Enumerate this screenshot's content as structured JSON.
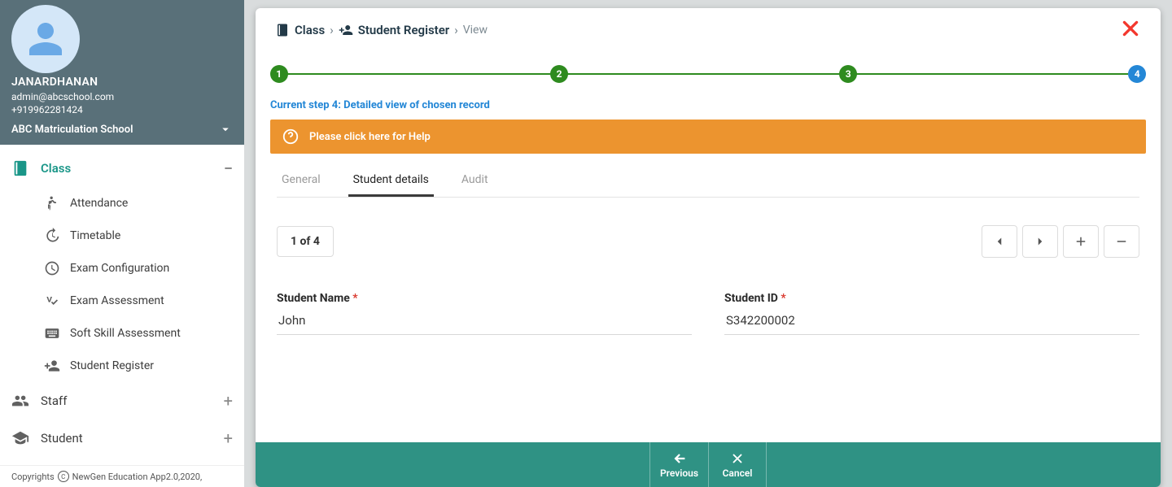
{
  "user": {
    "name": "JANARDHANAN",
    "email": "admin@abcschool.com",
    "phone": "+919962281424",
    "school": "ABC Matriculation School"
  },
  "sidebar": {
    "sections": {
      "class": {
        "label": "Class"
      },
      "staff": {
        "label": "Staff"
      },
      "student": {
        "label": "Student"
      }
    },
    "class_items": [
      {
        "label": "Attendance"
      },
      {
        "label": "Timetable"
      },
      {
        "label": "Exam Configuration"
      },
      {
        "label": "Exam Assessment"
      },
      {
        "label": "Soft Skill Assessment"
      },
      {
        "label": "Student Register"
      }
    ]
  },
  "breadcrumb": {
    "root": "Class",
    "module": "Student Register",
    "leaf": "View"
  },
  "stepper": {
    "steps": [
      "1",
      "2",
      "3",
      "4"
    ],
    "caption": "Current step 4: Detailed view of chosen record"
  },
  "help": {
    "text": "Please click here for Help"
  },
  "tabs": {
    "general": "General",
    "student_details": "Student details",
    "audit": "Audit"
  },
  "pager": {
    "text": "1 of 4"
  },
  "fields": {
    "student_name": {
      "label": "Student Name",
      "value": "John"
    },
    "student_id": {
      "label": "Student ID",
      "value": "S342200002"
    }
  },
  "actions": {
    "previous": "Previous",
    "cancel": "Cancel"
  },
  "footer": {
    "copyright_prefix": "Copyrights",
    "copyright_text": "NewGen Education App2.0,2020,"
  }
}
